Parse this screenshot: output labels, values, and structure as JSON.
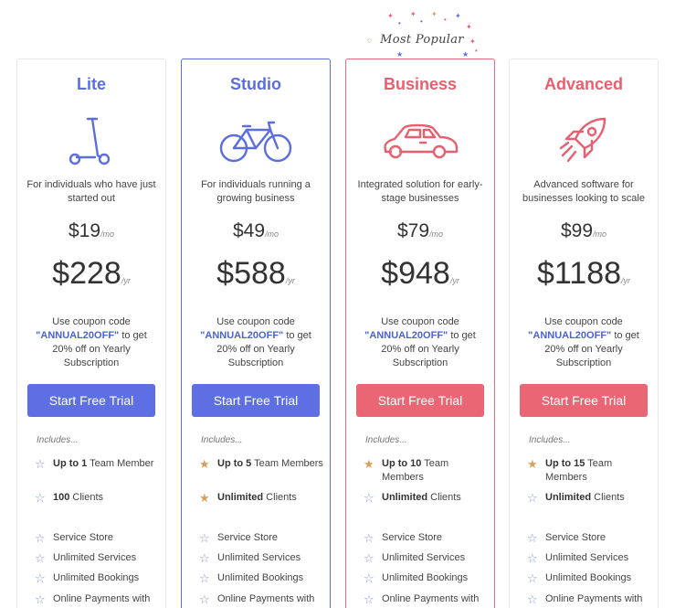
{
  "badge": {
    "label": "Most Popular"
  },
  "colors": {
    "blue": "#5d6fe3",
    "red": "#ea6674",
    "star_outline": "#8a98d8",
    "star_filled": "#d9a05b"
  },
  "plans": [
    {
      "name": "Lite",
      "name_color": "#5a6ee0",
      "icon": "scooter-icon",
      "description": "For individuals who have just started out",
      "monthly_price": "$19",
      "monthly_unit": "/mo",
      "yearly_price": "$228",
      "yearly_unit": "/yr",
      "coupon_before": "Use coupon code ",
      "coupon_code": "\"ANNUAL20OFF\"",
      "coupon_after": " to get 20% off on Yearly Subscription",
      "cta_label": "Start Free Trial",
      "includes_label": "Includes...",
      "features": [
        {
          "bold": "Up to 1",
          "text": " Team Member",
          "star": "outline"
        },
        {
          "bold": "100",
          "text": " Clients",
          "star": "outline"
        },
        {
          "bold": "",
          "text": "Service Store",
          "star": "outline"
        },
        {
          "bold": "",
          "text": "Unlimited Services",
          "star": "outline"
        },
        {
          "bold": "",
          "text": "Unlimited Bookings",
          "star": "outline"
        },
        {
          "bold": "",
          "text": "Online Payments with Stripe & PayPal",
          "star": "outline"
        }
      ]
    },
    {
      "name": "Studio",
      "name_color": "#5a6ee0",
      "icon": "bicycle-icon",
      "description": "For individuals running a growing business",
      "monthly_price": "$49",
      "monthly_unit": "/mo",
      "yearly_price": "$588",
      "yearly_unit": "/yr",
      "coupon_before": "Use coupon code ",
      "coupon_code": "\"ANNUAL20OFF\"",
      "coupon_after": " to get 20% off on Yearly Subscription",
      "cta_label": "Start Free Trial",
      "includes_label": "Includes...",
      "features": [
        {
          "bold": "Up to 5",
          "text": " Team Members",
          "star": "filled"
        },
        {
          "bold": "Unlimited",
          "text": " Clients",
          "star": "filled"
        },
        {
          "bold": "",
          "text": "Service Store",
          "star": "outline"
        },
        {
          "bold": "",
          "text": "Unlimited Services",
          "star": "outline"
        },
        {
          "bold": "",
          "text": "Unlimited Bookings",
          "star": "outline"
        },
        {
          "bold": "",
          "text": "Online Payments with Stripe & PayPal",
          "star": "outline"
        }
      ]
    },
    {
      "name": "Business",
      "name_color": "#e8606f",
      "icon": "car-icon",
      "description": "Integrated solution for early-stage businesses",
      "monthly_price": "$79",
      "monthly_unit": "/mo",
      "yearly_price": "$948",
      "yearly_unit": "/yr",
      "coupon_before": "Use coupon code ",
      "coupon_code": "\"ANNUAL20OFF\"",
      "coupon_after": " to get 20% off on Yearly Subscription",
      "cta_label": "Start Free Trial",
      "includes_label": "Includes...",
      "features": [
        {
          "bold": "Up to 10",
          "text": " Team Members",
          "star": "filled"
        },
        {
          "bold": "Unlimited",
          "text": " Clients",
          "star": "outline"
        },
        {
          "bold": "",
          "text": "Service Store",
          "star": "outline"
        },
        {
          "bold": "",
          "text": "Unlimited Services",
          "star": "outline"
        },
        {
          "bold": "",
          "text": "Unlimited Bookings",
          "star": "outline"
        },
        {
          "bold": "",
          "text": "Online Payments with Stripe & PayPal",
          "star": "outline"
        }
      ]
    },
    {
      "name": "Advanced",
      "name_color": "#e8606f",
      "icon": "rocket-icon",
      "description": "Advanced software for businesses looking to scale",
      "monthly_price": "$99",
      "monthly_unit": "/mo",
      "yearly_price": "$1188",
      "yearly_unit": "/yr",
      "coupon_before": "Use coupon code ",
      "coupon_code": "\"ANNUAL20OFF\"",
      "coupon_after": " to get 20% off on Yearly Subscription",
      "cta_label": "Start Free Trial",
      "includes_label": "Includes...",
      "features": [
        {
          "bold": "Up to 15",
          "text": " Team Members",
          "star": "filled"
        },
        {
          "bold": "Unlimited",
          "text": " Clients",
          "star": "outline"
        },
        {
          "bold": "",
          "text": "Service Store",
          "star": "outline"
        },
        {
          "bold": "",
          "text": "Unlimited Services",
          "star": "outline"
        },
        {
          "bold": "",
          "text": "Unlimited Bookings",
          "star": "outline"
        },
        {
          "bold": "",
          "text": "Online Payments with Stripe & PayPal",
          "star": "outline"
        }
      ]
    }
  ]
}
